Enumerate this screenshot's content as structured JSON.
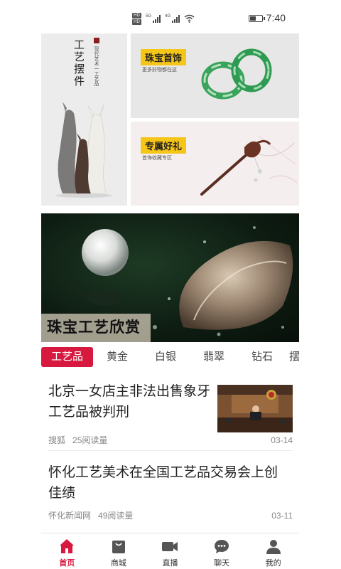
{
  "status_bar": {
    "hd_labels": [
      "HD",
      "HD"
    ],
    "signal1_label": "5G",
    "signal2_label": "4G",
    "time": "7:40",
    "battery_level": 0.55
  },
  "banners": {
    "left": {
      "title": "工艺摆件",
      "subtitle": "现代艺术一工艺品"
    },
    "right_top": {
      "tag": "珠宝首饰",
      "subtitle": "更多好物都在这"
    },
    "right_bottom": {
      "tag": "专属好礼",
      "subtitle": "首饰收藏专区"
    },
    "main": {
      "caption": "珠宝工艺欣赏"
    }
  },
  "tabs": [
    {
      "label": "工艺品",
      "active": true
    },
    {
      "label": "黄金",
      "active": false
    },
    {
      "label": "白银",
      "active": false
    },
    {
      "label": "翡翠",
      "active": false
    },
    {
      "label": "钻石",
      "active": false
    },
    {
      "label": "摆",
      "active": false
    }
  ],
  "news": [
    {
      "title": "北京一女店主非法出售象牙工艺品被判刑",
      "source": "搜狐",
      "reads": "25阅读量",
      "date": "03-14"
    },
    {
      "title": "怀化工艺美术在全国工艺品交易会上创佳绩",
      "source": "怀化新闻网",
      "reads": "49阅读量",
      "date": "03-11"
    }
  ],
  "bottom_nav": [
    {
      "label": "首页",
      "icon": "home-icon",
      "active": true
    },
    {
      "label": "商城",
      "icon": "shopping-bag-icon",
      "active": false
    },
    {
      "label": "直播",
      "icon": "video-camera-icon",
      "active": false
    },
    {
      "label": "聊天",
      "icon": "chat-icon",
      "active": false
    },
    {
      "label": "我的",
      "icon": "user-icon",
      "active": false
    }
  ],
  "colors": {
    "accent": "#d7193f",
    "tag_yellow": "#f5c518",
    "text_muted": "#888888"
  }
}
